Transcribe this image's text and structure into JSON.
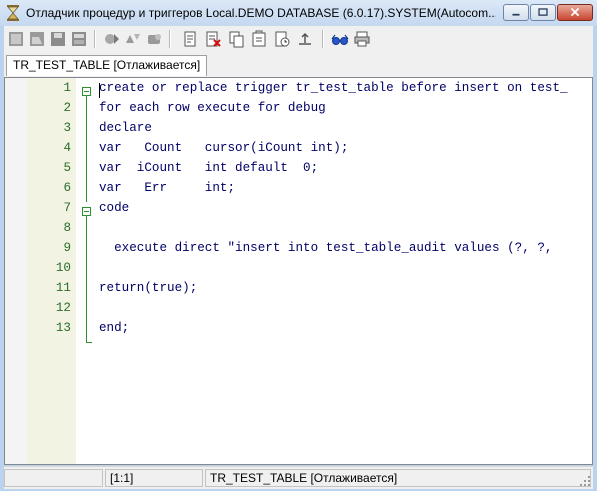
{
  "window": {
    "title": "Отладчик процедур и триггеров Local.DEMO DATABASE (6.0.17).SYSTEM(Autocom...",
    "icon": "hourglass-icon"
  },
  "toolbar": {
    "buttons": [
      "new-icon",
      "open-icon",
      "save-icon",
      "save-all-icon",
      "run-icon",
      "step-into-icon",
      "step-over-icon",
      "document-icon",
      "delete-breakpoint-icon",
      "copy-icon",
      "paste-icon",
      "watch-icon",
      "step-out-icon",
      "eyeglasses-icon",
      "print-icon"
    ]
  },
  "tabs": [
    {
      "label": "TR_TEST_TABLE [Отлаживается]",
      "active": true
    }
  ],
  "editor": {
    "lines": [
      {
        "num": "1",
        "text": "create or replace trigger tr_test_table before insert on test_"
      },
      {
        "num": "2",
        "text": "for each row execute for debug"
      },
      {
        "num": "3",
        "text": "declare"
      },
      {
        "num": "4",
        "text": "var   Count   cursor(iCount int);"
      },
      {
        "num": "5",
        "text": "var  iCount   int default  0;"
      },
      {
        "num": "6",
        "text": "var   Err     int;"
      },
      {
        "num": "7",
        "text": "code"
      },
      {
        "num": "8",
        "text": ""
      },
      {
        "num": "9",
        "text": "  execute direct \"insert into test_table_audit values (?, ?,"
      },
      {
        "num": "10",
        "text": ""
      },
      {
        "num": "11",
        "text": "return(true);"
      },
      {
        "num": "12",
        "text": ""
      },
      {
        "num": "13",
        "text": "end;"
      }
    ]
  },
  "statusbar": {
    "position": "[1:1]",
    "object": "TR_TEST_TABLE [Отлаживается]"
  },
  "colors": {
    "line_number": "#2a6e2a",
    "code_text": "#000066",
    "fold_marker": "#2f8f2f",
    "gutter": "#f3f3e4"
  }
}
